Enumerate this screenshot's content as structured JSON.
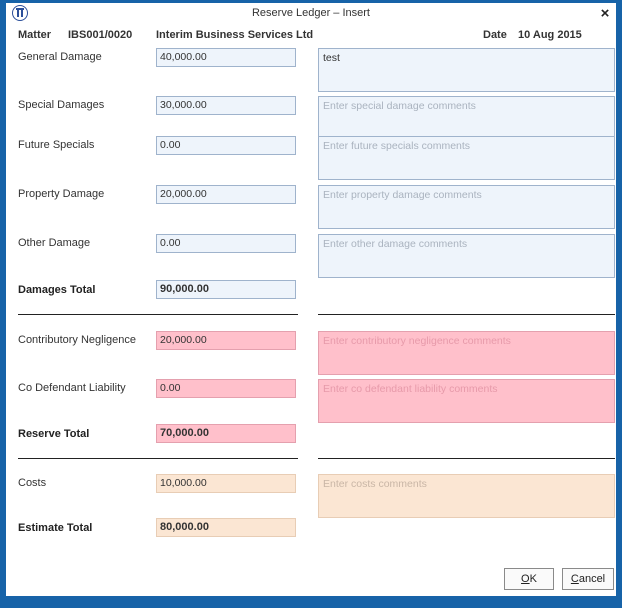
{
  "window": {
    "title": "Reserve Ledger – Insert",
    "close_glyph": "×"
  },
  "header": {
    "matter_label": "Matter",
    "matter_value": "IBS001/0020",
    "client_name": "Interim Business Services Ltd",
    "date_label": "Date",
    "date_value": "10 Aug 2015"
  },
  "damages": {
    "general": {
      "label": "General Damage",
      "amount": "40,000.00",
      "comment": "test"
    },
    "special": {
      "label": "Special Damages",
      "amount": "30,000.00",
      "comment_placeholder": "Enter special damage comments"
    },
    "future": {
      "label": "Future Specials",
      "amount": "0.00",
      "comment_placeholder": "Enter future specials comments"
    },
    "property": {
      "label": "Property Damage",
      "amount": "20,000.00",
      "comment_placeholder": "Enter property damage comments"
    },
    "other": {
      "label": "Other Damage",
      "amount": "0.00",
      "comment_placeholder": "Enter other damage comments"
    },
    "total_label": "Damages Total",
    "total_value": "90,000.00"
  },
  "reserve": {
    "contributory": {
      "label": "Contributory Negligence",
      "amount": "20,000.00",
      "comment_placeholder": "Enter contributory negligence comments"
    },
    "codefendant": {
      "label": "Co Defendant Liability",
      "amount": "0.00",
      "comment_placeholder": "Enter co defendant liability comments"
    },
    "total_label": "Reserve Total",
    "total_value": "70,000.00"
  },
  "estimate": {
    "costs": {
      "label": "Costs",
      "amount": "10,000.00",
      "comment_placeholder": "Enter costs comments"
    },
    "total_label": "Estimate Total",
    "total_value": "80,000.00"
  },
  "buttons": {
    "ok": {
      "mnemonic": "O",
      "rest": "K"
    },
    "cancel": {
      "mnemonic": "C",
      "rest": "ancel"
    }
  },
  "colors": {
    "frame": "#1763a8",
    "field_blue": "#eef4fb",
    "field_pink": "#ffc0cb",
    "field_peach": "#fbe6d3"
  }
}
